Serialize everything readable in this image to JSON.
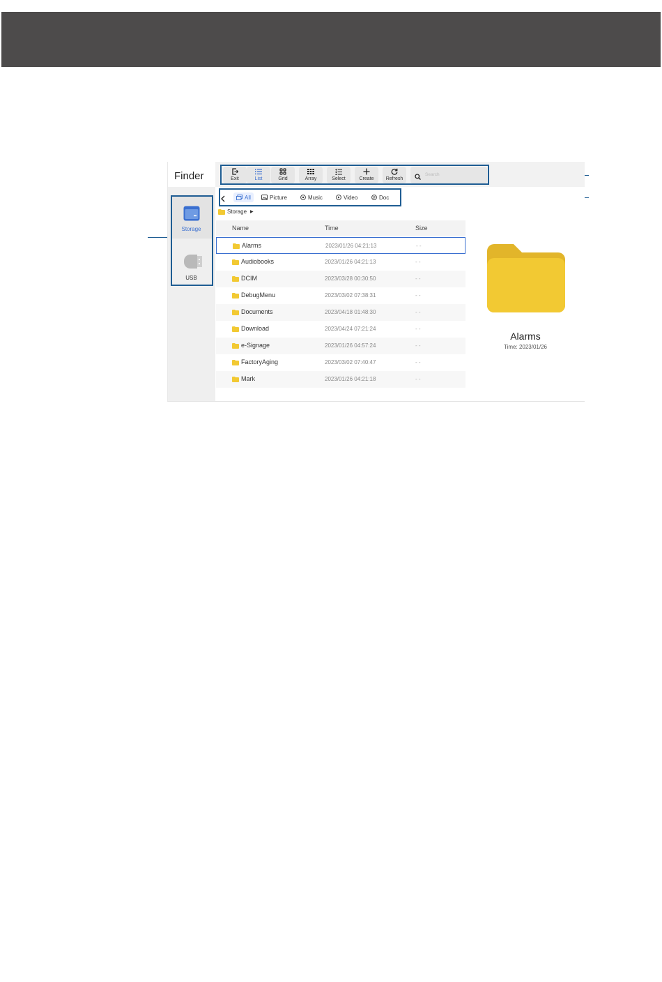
{
  "app": {
    "title": "Finder"
  },
  "toolbar": {
    "buttons": [
      {
        "label": "Exit",
        "icon": "exit-icon"
      },
      {
        "label": "List",
        "icon": "list-icon",
        "active": true
      },
      {
        "label": "Grid",
        "icon": "grid-icon"
      },
      {
        "label": "Array",
        "icon": "array-icon"
      },
      {
        "label": "Select",
        "icon": "select-icon"
      },
      {
        "label": "Create",
        "icon": "plus-icon"
      },
      {
        "label": "Refresh",
        "icon": "refresh-icon"
      }
    ],
    "search_placeholder": "Search"
  },
  "filters": {
    "tabs": [
      {
        "label": "All",
        "icon": "all-files-icon",
        "active": true
      },
      {
        "label": "Picture",
        "icon": "picture-icon"
      },
      {
        "label": "Music",
        "icon": "music-icon"
      },
      {
        "label": "Video",
        "icon": "video-icon"
      },
      {
        "label": "Doc",
        "icon": "doc-icon"
      }
    ]
  },
  "sidebar": {
    "items": [
      {
        "label": "Storage",
        "icon": "storage-icon",
        "active": true
      },
      {
        "label": "USB",
        "icon": "usb-icon"
      }
    ]
  },
  "breadcrumb": {
    "label": "Storage"
  },
  "table": {
    "headers": {
      "name": "Name",
      "time": "Time",
      "size": "Size"
    },
    "rows": [
      {
        "name": "Alarms",
        "time": "2023/01/26 04:21:13",
        "size": "- -"
      },
      {
        "name": "Audiobooks",
        "time": "2023/01/26 04:21:13",
        "size": "- -"
      },
      {
        "name": "DCIM",
        "time": "2023/03/28 00:30:50",
        "size": "- -"
      },
      {
        "name": "DebugMenu",
        "time": "2023/03/02 07:38:31",
        "size": "- -"
      },
      {
        "name": "Documents",
        "time": "2023/04/18 01:48:30",
        "size": "- -"
      },
      {
        "name": "Download",
        "time": "2023/04/24 07:21:24",
        "size": "- -"
      },
      {
        "name": "e-Signage",
        "time": "2023/01/26 04:57:24",
        "size": "- -"
      },
      {
        "name": "FactoryAging",
        "time": "2023/03/02 07:40:47",
        "size": "- -"
      },
      {
        "name": "Mark",
        "time": "2023/01/26 04:21:18",
        "size": "- -"
      }
    ]
  },
  "preview": {
    "name": "Alarms",
    "time": "Time: 2023/01/26"
  },
  "colors": {
    "accent": "#3a6fd0",
    "callout": "#1f5d93",
    "folder": "#f2c933",
    "header_band": "#4d4b4b"
  }
}
